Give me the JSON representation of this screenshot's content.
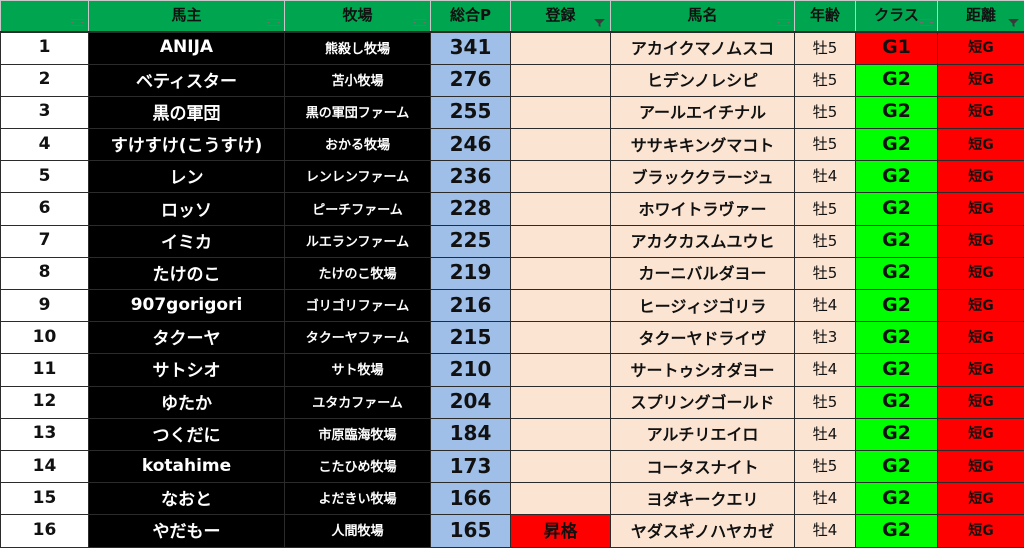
{
  "headers": {
    "rank": "",
    "owner": "馬主",
    "farm": "牧場",
    "points": "総合P",
    "reg": "登録",
    "horse": "馬名",
    "age": "年齢",
    "cls": "クラス",
    "dist": "距離"
  },
  "colors": {
    "header_green": "#00a550",
    "black_cell": "#000000",
    "points_blue": "#9fbfe9",
    "peach": "#fce4d2",
    "class_green": "#00ff00",
    "red": "#ff0000"
  },
  "rows": [
    {
      "rank": "1",
      "owner": "ANIJA",
      "farm": "熊殺し牧場",
      "points": "341",
      "reg": "",
      "horse": "アカイクマノムスコ",
      "age": "牡5",
      "cls": "G1",
      "dist": "短G"
    },
    {
      "rank": "2",
      "owner": "ベティスター",
      "farm": "苫小牧場",
      "points": "276",
      "reg": "",
      "horse": "ヒデンノレシピ",
      "age": "牡5",
      "cls": "G2",
      "dist": "短G"
    },
    {
      "rank": "3",
      "owner": "黒の軍団",
      "farm": "黒の軍団ファーム",
      "points": "255",
      "reg": "",
      "horse": "アールエイチナル",
      "age": "牡5",
      "cls": "G2",
      "dist": "短G"
    },
    {
      "rank": "4",
      "owner": "すけすけ(こうすけ)",
      "farm": "おかる牧場",
      "points": "246",
      "reg": "",
      "horse": "ササキキングマコト",
      "age": "牡5",
      "cls": "G2",
      "dist": "短G"
    },
    {
      "rank": "5",
      "owner": "レン",
      "farm": "レンレンファーム",
      "points": "236",
      "reg": "",
      "horse": "ブラッククラージュ",
      "age": "牡4",
      "cls": "G2",
      "dist": "短G"
    },
    {
      "rank": "6",
      "owner": "ロッソ",
      "farm": "ピーチファーム",
      "points": "228",
      "reg": "",
      "horse": "ホワイトラヴァー",
      "age": "牡5",
      "cls": "G2",
      "dist": "短G"
    },
    {
      "rank": "7",
      "owner": "イミカ",
      "farm": "ルエランファーム",
      "points": "225",
      "reg": "",
      "horse": "アカクカスムユウヒ",
      "age": "牡5",
      "cls": "G2",
      "dist": "短G"
    },
    {
      "rank": "8",
      "owner": "たけのこ",
      "farm": "たけのこ牧場",
      "points": "219",
      "reg": "",
      "horse": "カーニバルダヨー",
      "age": "牡5",
      "cls": "G2",
      "dist": "短G"
    },
    {
      "rank": "9",
      "owner": "907gorigori",
      "farm": "ゴリゴリファーム",
      "points": "216",
      "reg": "",
      "horse": "ヒージィジゴリラ",
      "age": "牡4",
      "cls": "G2",
      "dist": "短G"
    },
    {
      "rank": "10",
      "owner": "タクーヤ",
      "farm": "タクーヤファーム",
      "points": "215",
      "reg": "",
      "horse": "タクーヤドライヴ",
      "age": "牡3",
      "cls": "G2",
      "dist": "短G"
    },
    {
      "rank": "11",
      "owner": "サトシオ",
      "farm": "サト牧場",
      "points": "210",
      "reg": "",
      "horse": "サートゥシオダヨー",
      "age": "牡4",
      "cls": "G2",
      "dist": "短G"
    },
    {
      "rank": "12",
      "owner": "ゆたか",
      "farm": "ユタカファーム",
      "points": "204",
      "reg": "",
      "horse": "スプリングゴールド",
      "age": "牡5",
      "cls": "G2",
      "dist": "短G"
    },
    {
      "rank": "13",
      "owner": "つくだに",
      "farm": "市原臨海牧場",
      "points": "184",
      "reg": "",
      "horse": "アルチリエイロ",
      "age": "牡4",
      "cls": "G2",
      "dist": "短G"
    },
    {
      "rank": "14",
      "owner": "kotahime",
      "farm": "こたひめ牧場",
      "points": "173",
      "reg": "",
      "horse": "コータスナイト",
      "age": "牡5",
      "cls": "G2",
      "dist": "短G"
    },
    {
      "rank": "15",
      "owner": "なおと",
      "farm": "よだきい牧場",
      "points": "166",
      "reg": "",
      "horse": "ヨダキークエリ",
      "age": "牡4",
      "cls": "G2",
      "dist": "短G"
    },
    {
      "rank": "16",
      "owner": "やだもー",
      "farm": "人間牧場",
      "points": "165",
      "reg": "昇格",
      "horse": "ヤダスギノハヤカゼ",
      "age": "牡4",
      "cls": "G2",
      "dist": "短G"
    }
  ]
}
